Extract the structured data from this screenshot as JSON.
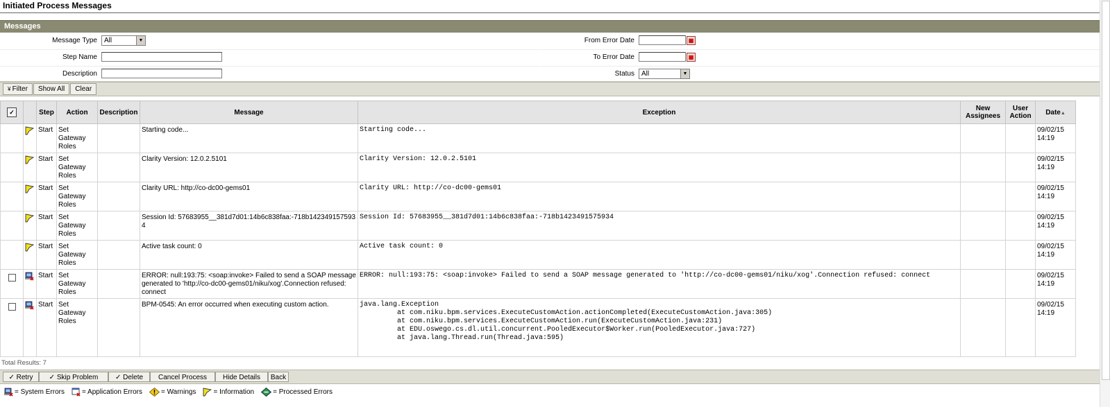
{
  "page": {
    "title": "Initiated Process Messages"
  },
  "messages_section": {
    "title": "Messages",
    "filters": {
      "message_type_label": "Message Type",
      "message_type_value": "All",
      "step_name_label": "Step Name",
      "step_name_value": "",
      "description_label": "Description",
      "description_value": "",
      "from_error_date_label": "From Error Date",
      "from_error_date_value": "",
      "to_error_date_label": "To Error Date",
      "to_error_date_value": "",
      "status_label": "Status",
      "status_value": "All"
    },
    "toolbar": {
      "filter": "Filter",
      "show_all": "Show All",
      "clear": "Clear"
    }
  },
  "table": {
    "columns": {
      "step": "Step",
      "action": "Action",
      "description": "Description",
      "message": "Message",
      "exception": "Exception",
      "new_assignees": "New Assignees",
      "user_action": "User Action",
      "date": "Date"
    },
    "rows": [
      {
        "checkbox": false,
        "icon": "information-flag-icon",
        "step": "Start",
        "action": "Set Gateway Roles",
        "description": "",
        "message": "Starting code...",
        "exception": "Starting code...",
        "new_assignees": "",
        "user_action": "",
        "date": "09/02/15 14:19"
      },
      {
        "checkbox": false,
        "icon": "information-flag-icon",
        "step": "Start",
        "action": "Set Gateway Roles",
        "description": "",
        "message": "Clarity Version: 12.0.2.5101",
        "exception": "Clarity Version: 12.0.2.5101",
        "new_assignees": "",
        "user_action": "",
        "date": "09/02/15 14:19"
      },
      {
        "checkbox": false,
        "icon": "information-flag-icon",
        "step": "Start",
        "action": "Set Gateway Roles",
        "description": "",
        "message": "Clarity URL: http://co-dc00-gems01",
        "exception": "Clarity URL: http://co-dc00-gems01",
        "new_assignees": "",
        "user_action": "",
        "date": "09/02/15 14:19"
      },
      {
        "checkbox": false,
        "icon": "information-flag-icon",
        "step": "Start",
        "action": "Set Gateway Roles",
        "description": "",
        "message": "Session Id: 57683955__381d7d01:14b6c838faa:-718b1423491575934",
        "exception": "Session Id: 57683955__381d7d01:14b6c838faa:-718b1423491575934",
        "new_assignees": "",
        "user_action": "",
        "date": "09/02/15 14:19"
      },
      {
        "checkbox": false,
        "icon": "information-flag-icon",
        "step": "Start",
        "action": "Set Gateway Roles",
        "description": "",
        "message": "Active task count: 0",
        "exception": "Active task count: 0",
        "new_assignees": "",
        "user_action": "",
        "date": "09/02/15 14:19"
      },
      {
        "checkbox": true,
        "icon": "system-error-icon",
        "step": "Start",
        "action": "Set Gateway Roles",
        "description": "",
        "message": "ERROR: null:193:75: <soap:invoke> Failed to send a SOAP message generated to 'http://co-dc00-gems01/niku/xog'.Connection refused: connect",
        "exception": "ERROR: null:193:75: <soap:invoke> Failed to send a SOAP message generated to 'http://co-dc00-gems01/niku/xog'.Connection refused: connect",
        "new_assignees": "",
        "user_action": "",
        "date": "09/02/15 14:19"
      },
      {
        "checkbox": true,
        "icon": "system-error-icon",
        "step": "Start",
        "action": "Set Gateway Roles",
        "description": "",
        "message": "BPM-0545: An error occurred when executing custom action.",
        "exception": "java.lang.Exception\n\tat com.niku.bpm.services.ExecuteCustomAction.actionCompleted(ExecuteCustomAction.java:305)\n\tat com.niku.bpm.services.ExecuteCustomAction.run(ExecuteCustomAction.java:231)\n\tat EDU.oswego.cs.dl.util.concurrent.PooledExecutor$Worker.run(PooledExecutor.java:727)\n\tat java.lang.Thread.run(Thread.java:595)",
        "new_assignees": "",
        "user_action": "",
        "date": "09/02/15 14:19"
      }
    ]
  },
  "total_results": "Total Results: 7",
  "actions": {
    "retry": "Retry",
    "skip_problem": "Skip Problem",
    "delete": "Delete",
    "cancel_process": "Cancel Process",
    "hide_details": "Hide Details",
    "back": "Back"
  },
  "legend": {
    "system_errors": "= System Errors",
    "application_errors": "= Application Errors",
    "warnings": "= Warnings",
    "information": "= Information",
    "processed_errors": "= Processed Errors"
  },
  "colors": {
    "section_header": "#8a8a72",
    "toolbar": "#e0dfd6",
    "table_header": "#e4e4e4",
    "flag_yellow": "#f2e01c",
    "error_red": "#cc1111",
    "processed_green": "#2e9a4a"
  }
}
